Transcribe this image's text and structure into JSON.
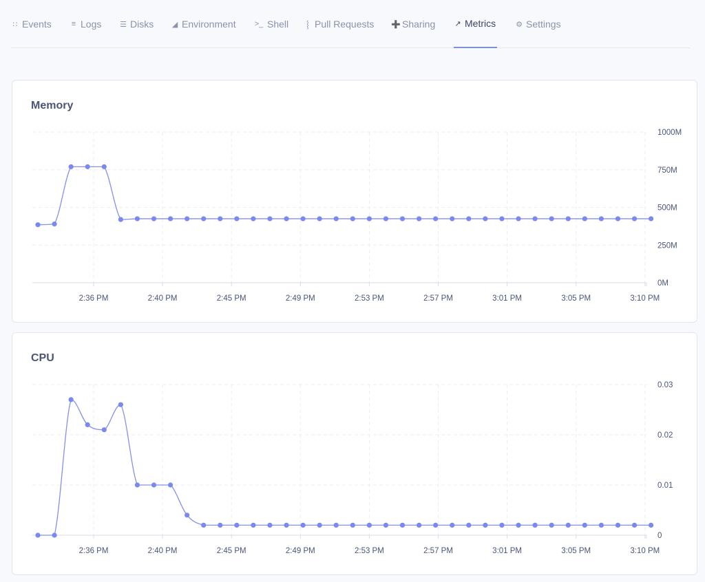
{
  "tabs": [
    {
      "label": "Events",
      "icon": "rss-icon",
      "glyph": "∷"
    },
    {
      "label": "Logs",
      "icon": "lines-icon",
      "glyph": "≡"
    },
    {
      "label": "Disks",
      "icon": "list-icon",
      "glyph": "☰"
    },
    {
      "label": "Environment",
      "icon": "sliders-icon",
      "glyph": "◢"
    },
    {
      "label": "Shell",
      "icon": "terminal-icon",
      "glyph": ">_"
    },
    {
      "label": "Pull Requests",
      "icon": "pull-request-icon",
      "glyph": "⸾"
    },
    {
      "label": "Sharing",
      "icon": "user-plus-icon",
      "glyph": "➕"
    },
    {
      "label": "Metrics",
      "icon": "trend-icon",
      "glyph": "↗"
    },
    {
      "label": "Settings",
      "icon": "gear-icon",
      "glyph": "⚙"
    }
  ],
  "active_tab": "Metrics",
  "colors": {
    "accent": "#7a89f0",
    "line": "#8290ee"
  },
  "chart_data": [
    {
      "type": "line",
      "title": "Memory",
      "x_tick_labels": [
        "2:36 PM",
        "2:40 PM",
        "2:45 PM",
        "2:49 PM",
        "2:53 PM",
        "2:57 PM",
        "3:01 PM",
        "3:05 PM",
        "3:10 PM"
      ],
      "y_tick_labels": [
        "1000M",
        "750M",
        "500M",
        "250M",
        "0M"
      ],
      "ylim": [
        0,
        1000
      ],
      "y_axis_position": "right",
      "grid": true,
      "values": [
        385,
        390,
        770,
        770,
        770,
        420,
        425,
        425,
        425,
        425,
        425,
        425,
        425,
        425,
        425,
        425,
        425,
        425,
        425,
        425,
        425,
        425,
        425,
        425,
        425,
        425,
        425,
        425,
        425,
        425,
        425,
        425,
        425,
        425,
        425,
        425,
        425,
        425
      ]
    },
    {
      "type": "line",
      "title": "CPU",
      "x_tick_labels": [
        "2:36 PM",
        "2:40 PM",
        "2:45 PM",
        "2:49 PM",
        "2:53 PM",
        "2:57 PM",
        "3:01 PM",
        "3:05 PM",
        "3:10 PM"
      ],
      "y_tick_labels": [
        "0.03",
        "0.02",
        "0.01",
        "0"
      ],
      "ylim": [
        0,
        0.03
      ],
      "y_axis_position": "right",
      "grid": true,
      "values": [
        0,
        0,
        0.027,
        0.022,
        0.021,
        0.026,
        0.01,
        0.01,
        0.01,
        0.004,
        0.002,
        0.002,
        0.002,
        0.002,
        0.002,
        0.002,
        0.002,
        0.002,
        0.002,
        0.002,
        0.002,
        0.002,
        0.002,
        0.002,
        0.002,
        0.002,
        0.002,
        0.002,
        0.002,
        0.002,
        0.002,
        0.002,
        0.002,
        0.002,
        0.002,
        0.002,
        0.002,
        0.002
      ]
    }
  ]
}
